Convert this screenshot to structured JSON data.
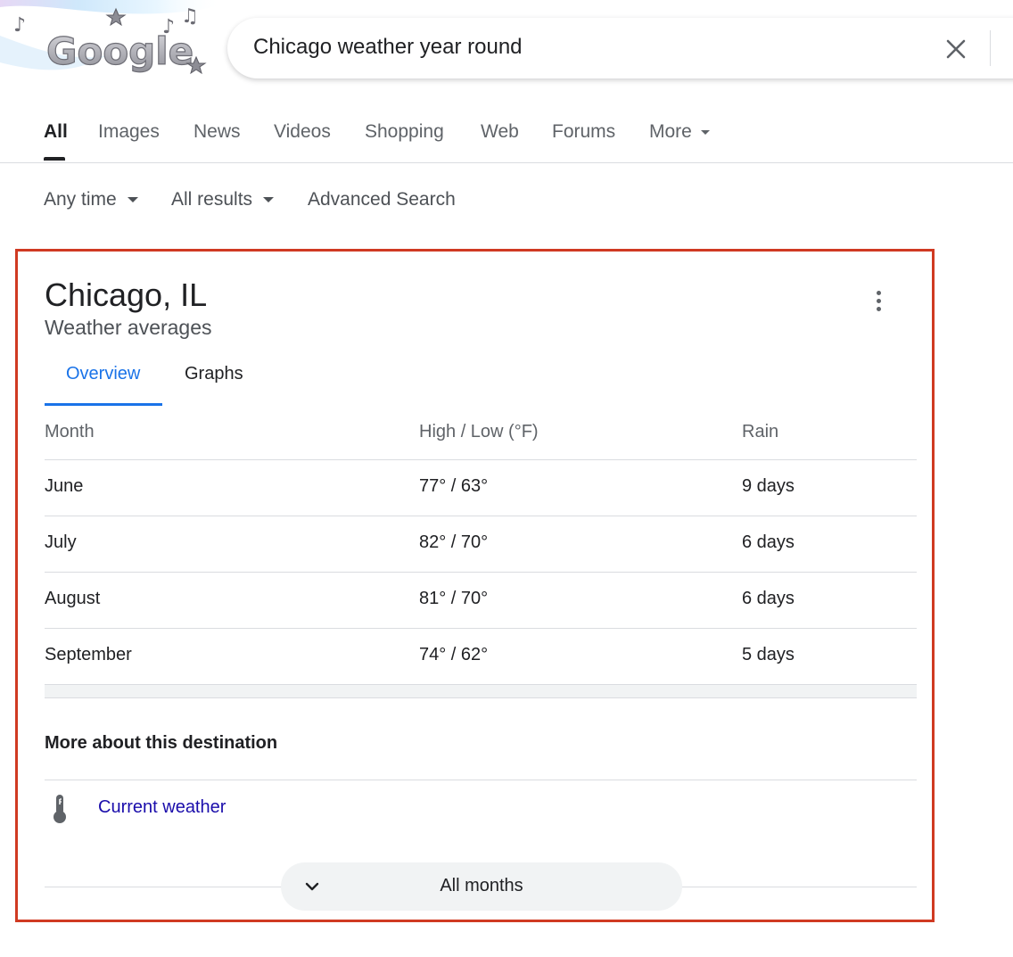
{
  "search": {
    "logo_text": "Google",
    "query": "Chicago weather year round"
  },
  "nav": {
    "tabs": [
      {
        "label": "All",
        "active": true
      },
      {
        "label": "Images"
      },
      {
        "label": "News"
      },
      {
        "label": "Videos"
      },
      {
        "label": "Shopping"
      },
      {
        "label": "Web"
      },
      {
        "label": "Forums"
      },
      {
        "label": "More"
      }
    ]
  },
  "tools": {
    "time": "Any time",
    "results": "All results",
    "advanced": "Advanced Search"
  },
  "card": {
    "title": "Chicago, IL",
    "subtitle": "Weather averages",
    "tabs": {
      "overview": "Overview",
      "graphs": "Graphs"
    },
    "table": {
      "headers": [
        "Month",
        "High / Low (°F)",
        "Rain"
      ],
      "rows": [
        [
          "June",
          "77° / 63°",
          "9 days"
        ],
        [
          "July",
          "82° / 70°",
          "6 days"
        ],
        [
          "August",
          "81° / 70°",
          "6 days"
        ],
        [
          "September",
          "74° / 62°",
          "5 days"
        ]
      ]
    },
    "more_heading": "More about this destination",
    "current_weather": "Current weather",
    "all_months": "All months"
  },
  "colors": {
    "accent_blue": "#1a73e8",
    "link_blue": "#1a0dab",
    "highlight_border": "#d03a22"
  },
  "icons": [
    "music-note-icon",
    "star-icon",
    "close-icon",
    "caret-down-icon",
    "more-vert-icon",
    "thermometer-icon",
    "chevron-down-icon"
  ]
}
